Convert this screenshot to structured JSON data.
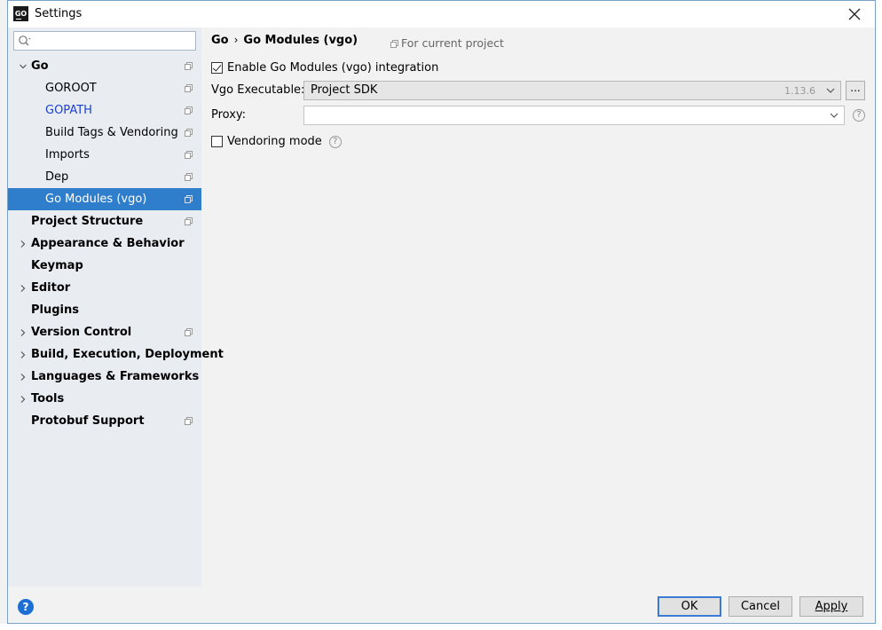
{
  "window": {
    "title": "Settings",
    "app_icon": "GO"
  },
  "search": {
    "placeholder": ""
  },
  "tree": [
    {
      "label": "Go",
      "bold": true,
      "level": 0,
      "expanded": true,
      "chevron": "down",
      "proj_icon": true
    },
    {
      "label": "GOROOT",
      "level": 1,
      "proj_icon": true
    },
    {
      "label": "GOPATH",
      "level": 1,
      "proj_icon": true,
      "link": true
    },
    {
      "label": "Build Tags & Vendoring",
      "level": 1,
      "proj_icon": true
    },
    {
      "label": "Imports",
      "level": 1,
      "proj_icon": true
    },
    {
      "label": "Dep",
      "level": 1,
      "proj_icon": true
    },
    {
      "label": "Go Modules (vgo)",
      "level": 1,
      "proj_icon": true,
      "selected": true
    },
    {
      "label": "Project Structure",
      "bold": true,
      "level": 0,
      "proj_icon": true
    },
    {
      "label": "Appearance & Behavior",
      "bold": true,
      "level": 0,
      "chevron": "right"
    },
    {
      "label": "Keymap",
      "bold": true,
      "level": 0
    },
    {
      "label": "Editor",
      "bold": true,
      "level": 0,
      "chevron": "right"
    },
    {
      "label": "Plugins",
      "bold": true,
      "level": 0
    },
    {
      "label": "Version Control",
      "bold": true,
      "level": 0,
      "chevron": "right",
      "proj_icon": true
    },
    {
      "label": "Build, Execution, Deployment",
      "bold": true,
      "level": 0,
      "chevron": "right"
    },
    {
      "label": "Languages & Frameworks",
      "bold": true,
      "level": 0,
      "chevron": "right"
    },
    {
      "label": "Tools",
      "bold": true,
      "level": 0,
      "chevron": "right"
    },
    {
      "label": "Protobuf Support",
      "bold": true,
      "level": 0,
      "proj_icon": true
    }
  ],
  "breadcrumb": {
    "parent": "Go",
    "separator": "›",
    "current": "Go Modules (vgo)"
  },
  "scope": {
    "label": "For current project"
  },
  "settings": {
    "enable_vgo": {
      "label": "Enable Go Modules (vgo) integration",
      "checked": true
    },
    "vgo_executable": {
      "label": "Vgo Executable:",
      "value": "Project SDK",
      "version": "1.13.6",
      "browse": "..."
    },
    "proxy": {
      "label": "Proxy:",
      "value": ""
    },
    "vendoring": {
      "label": "Vendoring mode",
      "checked": false
    }
  },
  "buttons": {
    "ok": "OK",
    "cancel": "Cancel",
    "apply": "Apply",
    "help": "?"
  },
  "colors": {
    "selection": "#2f7ecb",
    "sidebar": "#e9edf2",
    "link": "#1a3fd6",
    "help": "#1e6fd4"
  }
}
